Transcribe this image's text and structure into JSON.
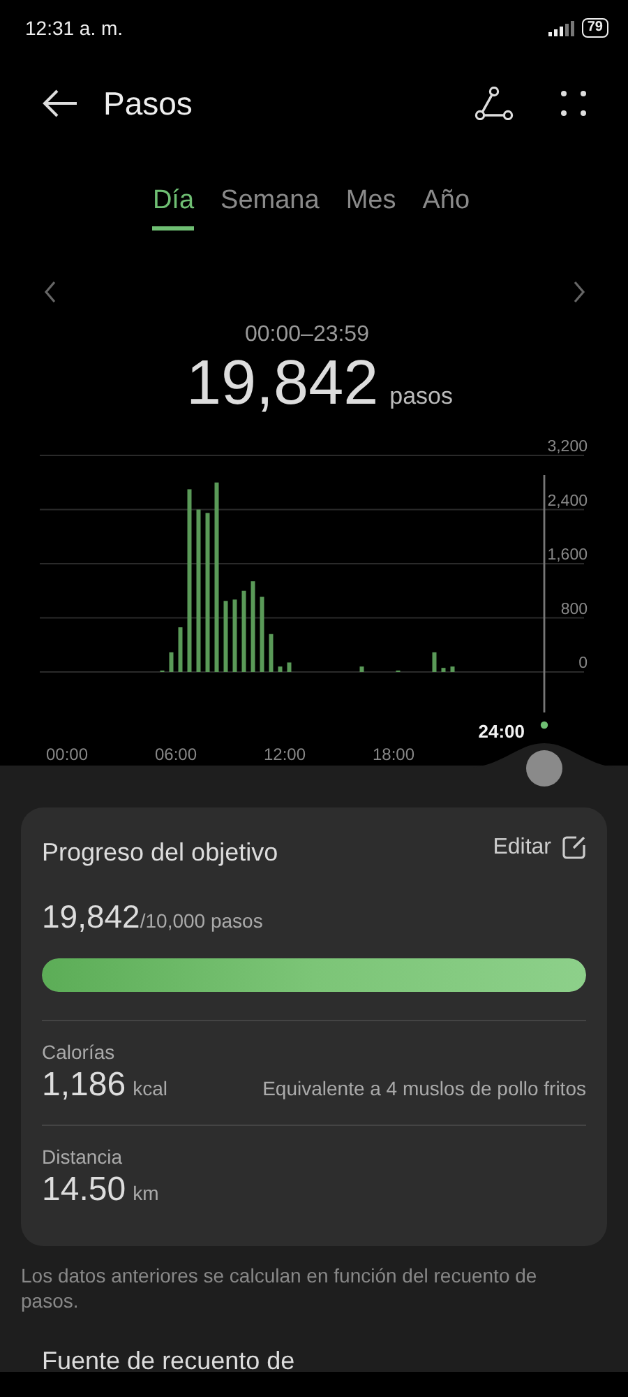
{
  "status_bar": {
    "time": "12:31 a. m.",
    "battery": "79"
  },
  "header": {
    "title": "Pasos"
  },
  "tabs": [
    {
      "label": "Día",
      "selected": true
    },
    {
      "label": "Semana",
      "selected": false
    },
    {
      "label": "Mes",
      "selected": false
    },
    {
      "label": "Año",
      "selected": false
    }
  ],
  "summary": {
    "range": "00:00–23:59",
    "total": "19,842",
    "unit": "pasos"
  },
  "chart": {
    "cursor_label": "24:00",
    "chart_data": {
      "type": "bar",
      "grid": true,
      "xlim": [
        -1.5,
        28.5
      ],
      "x": [
        5.25,
        5.75,
        6.25,
        6.75,
        7.25,
        7.75,
        8.25,
        8.75,
        9.25,
        9.75,
        10.25,
        10.75,
        11.25,
        11.75,
        12.25,
        16.25,
        18.25,
        20.25,
        20.75,
        21.25
      ],
      "values": [
        20,
        290,
        660,
        2700,
        2400,
        2350,
        2800,
        1050,
        1070,
        1200,
        1340,
        1110,
        560,
        80,
        140,
        80,
        20,
        290,
        60,
        80
      ],
      "ylim": [
        0,
        3200
      ],
      "yticks": [
        {
          "value": 0,
          "label": "0"
        },
        {
          "value": 800,
          "label": "800"
        },
        {
          "value": 1600,
          "label": "1,600"
        },
        {
          "value": 2400,
          "label": "2,400"
        },
        {
          "value": 3200,
          "label": "3,200"
        }
      ],
      "xticks": [
        {
          "value": 0,
          "label": "00:00"
        },
        {
          "value": 6,
          "label": "06:00"
        },
        {
          "value": 12,
          "label": "12:00"
        },
        {
          "value": 18,
          "label": "18:00"
        }
      ]
    }
  },
  "goal_card": {
    "title": "Progreso del objetivo",
    "edit_label": "Editar",
    "value": "19,842",
    "goal": "/10,000 pasos",
    "level": 1,
    "stats": [
      {
        "label": "Calorías",
        "value": "1,186",
        "unit": "kcal",
        "note": "Equivalente a 4 muslos de pollo fritos"
      },
      {
        "label": "Distancia",
        "value": "14.50",
        "unit": "km"
      }
    ]
  },
  "footnote": "Los datos anteriores se calculan en función del recuento de pasos.",
  "section_heading": "Fuente de recuento de"
}
